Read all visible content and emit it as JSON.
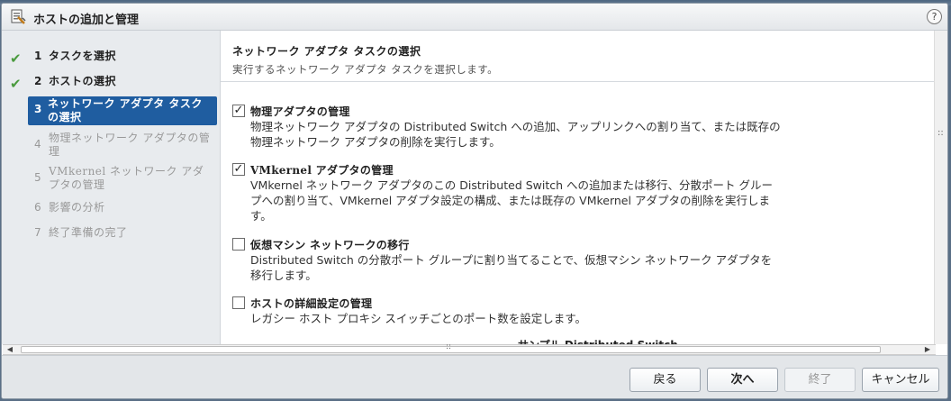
{
  "window": {
    "title": "ホストの追加と管理",
    "help_label": "?"
  },
  "steps": [
    {
      "num": "1",
      "label": "タスクを選択",
      "state": "done"
    },
    {
      "num": "2",
      "label": "ホストの選択",
      "state": "done"
    },
    {
      "num": "3",
      "label": "ネットワーク アダプタ タスクの選択",
      "state": "current"
    },
    {
      "num": "4",
      "label": "物理ネットワーク アダプタの管理",
      "state": "future"
    },
    {
      "num": "5",
      "label": "VMkernel ネットワーク アダプタの管理",
      "state": "future"
    },
    {
      "num": "6",
      "label": "影響の分析",
      "state": "future"
    },
    {
      "num": "7",
      "label": "終了準備の完了",
      "state": "future"
    }
  ],
  "main": {
    "title": "ネットワーク アダプタ タスクの選択",
    "subtitle": "実行するネットワーク アダプタ タスクを選択します。",
    "options": [
      {
        "checked": true,
        "title": "物理アダプタの管理",
        "description": "物理ネットワーク アダプタの Distributed Switch への追加、アップリンクへの割り当て、または既存の物理ネットワーク アダプタの削除を実行します。"
      },
      {
        "checked": true,
        "title": "VMkernel アダプタの管理",
        "description": "VMkernel ネットワーク アダプタのこの Distributed Switch への追加または移行、分散ポート グループへの割り当て、VMkernel アダプタ設定の構成、または既存の VMkernel アダプタの削除を実行します。"
      },
      {
        "checked": false,
        "title": "仮想マシン ネットワークの移行",
        "description": "Distributed Switch の分散ポート グループに割り当てることで、仮想マシン ネットワーク アダプタを移行します。"
      },
      {
        "checked": false,
        "title": "ホストの詳細設定の管理",
        "description": "レガシー ホスト プロキシ スイッチごとのポート数を設定します。"
      }
    ],
    "cutoff_text": "サンプル Distributed Switch"
  },
  "footer": {
    "back_label": "戻る",
    "next_label": "次へ",
    "finish_label": "終了",
    "cancel_label": "キャンセル"
  },
  "colors": {
    "current_step_bg": "#1f5da0",
    "check_green": "#4a9b3e",
    "sidebar_bg": "#e8ebee"
  }
}
